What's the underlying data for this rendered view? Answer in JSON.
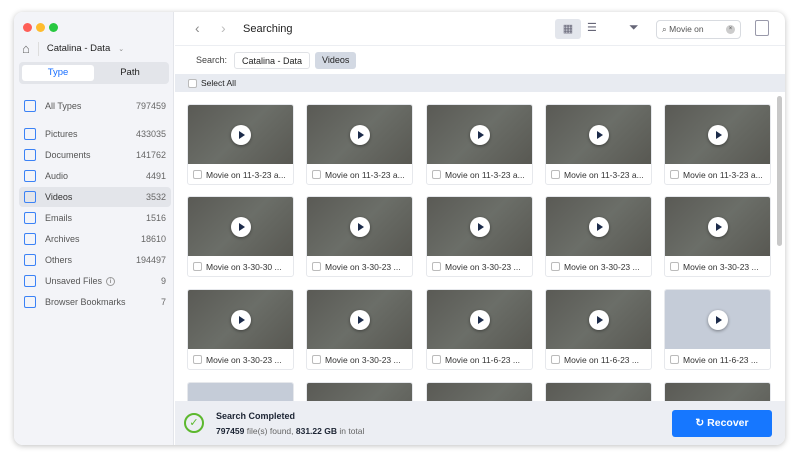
{
  "sidebar": {
    "drive": "Catalina - Data",
    "tabs": [
      "Type",
      "Path"
    ],
    "items": [
      {
        "label": "All Types",
        "count": "797459"
      },
      {
        "label": "Pictures",
        "count": "433035"
      },
      {
        "label": "Documents",
        "count": "141762"
      },
      {
        "label": "Audio",
        "count": "4491"
      },
      {
        "label": "Videos",
        "count": "3532"
      },
      {
        "label": "Emails",
        "count": "1516"
      },
      {
        "label": "Archives",
        "count": "18610"
      },
      {
        "label": "Others",
        "count": "194497"
      },
      {
        "label": "Unsaved Files",
        "count": "9"
      },
      {
        "label": "Browser Bookmarks",
        "count": "7"
      }
    ]
  },
  "header": {
    "title": "Searching",
    "search_value": "Movie on"
  },
  "search": {
    "label": "Search:",
    "chips": [
      "Catalina - Data",
      "Videos"
    ]
  },
  "select_all": "Select All",
  "files": [
    "Movie on 11-3-23 a...",
    "Movie on 11-3-23 a...",
    "Movie on 11-3-23 a...",
    "Movie on 11-3-23 a...",
    "Movie on 11-3-23 a...",
    "Movie on 3-30-30 ...",
    "Movie on 3-30-23 ...",
    "Movie on 3-30-23 ...",
    "Movie on 3-30-23 ...",
    "Movie on 3-30-23 ...",
    "Movie on 3-30-23 ...",
    "Movie on 3-30-23 ...",
    "Movie on 11-6-23 ...",
    "Movie on 11-6-23 ...",
    "Movie on 11-6-23 ..."
  ],
  "footer": {
    "title": "Search Completed",
    "count": "797459",
    "count_suffix": " file(s) found, ",
    "size": "831.22 GB",
    "size_suffix": " in total",
    "recover": "Recover"
  }
}
